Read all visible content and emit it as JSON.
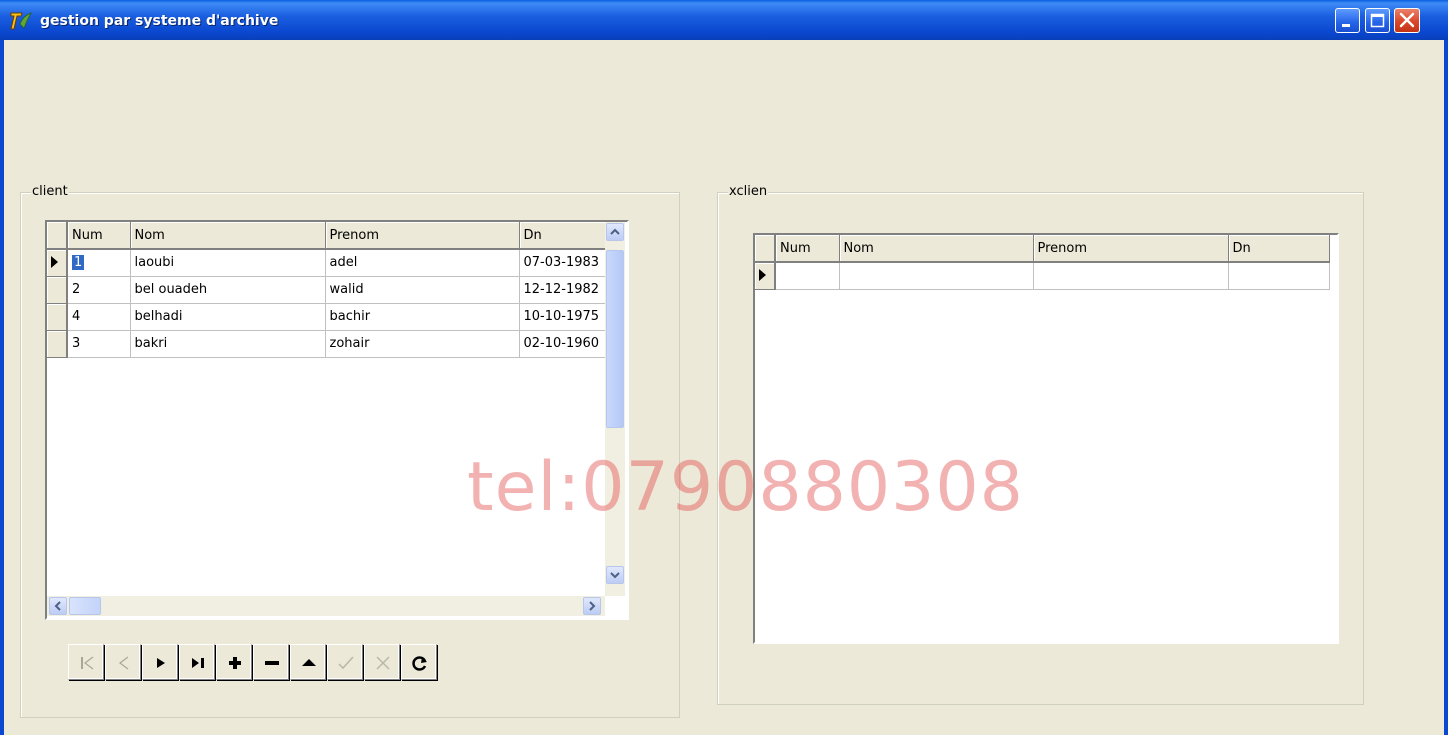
{
  "window": {
    "title": "gestion  par systeme d'archive"
  },
  "client_group": {
    "legend": "client",
    "columns": [
      "Num",
      "Nom",
      "Prenom",
      "Dn"
    ],
    "rows": [
      {
        "num": "1",
        "nom": "laoubi",
        "prenom": "adel",
        "dn": "07-03-1983"
      },
      {
        "num": "2",
        "nom": "bel ouadeh",
        "prenom": "walid",
        "dn": "12-12-1982"
      },
      {
        "num": "4",
        "nom": "belhadi",
        "prenom": "bachir",
        "dn": "10-10-1975"
      },
      {
        "num": "3",
        "nom": "bakri",
        "prenom": "zohair",
        "dn": "02-10-1960"
      }
    ],
    "current_row": 0
  },
  "navigator": {
    "buttons": [
      {
        "name": "first-record-button",
        "icon": "first-icon",
        "enabled": false
      },
      {
        "name": "prior-record-button",
        "icon": "prior-icon",
        "enabled": false
      },
      {
        "name": "next-record-button",
        "icon": "next-icon",
        "enabled": true
      },
      {
        "name": "last-record-button",
        "icon": "last-icon",
        "enabled": true
      },
      {
        "name": "insert-record-button",
        "icon": "plus-icon",
        "enabled": true
      },
      {
        "name": "delete-record-button",
        "icon": "minus-icon",
        "enabled": true
      },
      {
        "name": "edit-record-button",
        "icon": "edit-up-icon",
        "enabled": true
      },
      {
        "name": "post-record-button",
        "icon": "check-icon",
        "enabled": false
      },
      {
        "name": "cancel-record-button",
        "icon": "cancel-icon",
        "enabled": false
      },
      {
        "name": "refresh-record-button",
        "icon": "refresh-icon",
        "enabled": true
      }
    ]
  },
  "xclient_group": {
    "legend": "xclien",
    "columns": [
      "Num",
      "Nom",
      "Prenom",
      "Dn"
    ]
  },
  "watermark": "tel:0790880308",
  "colors": {
    "titlebar": "#0A48D0",
    "face": "#ECE9D8",
    "selection": "#316AC5",
    "watermark": "#E44A4A"
  }
}
